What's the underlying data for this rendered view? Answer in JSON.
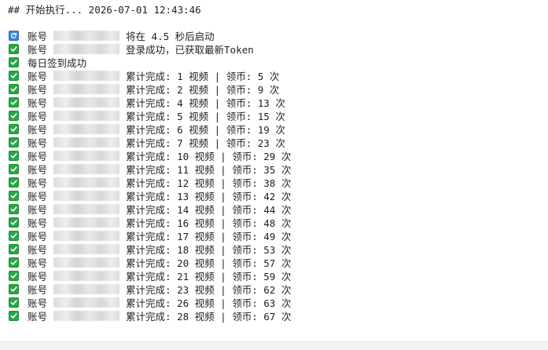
{
  "header": {
    "text": "## 开始执行... 2026-07-01 12:43:46"
  },
  "log": {
    "lines": [
      {
        "icon": "refresh-icon",
        "label": "账号",
        "masked": true,
        "message": "将在 4.5 秒后启动"
      },
      {
        "icon": "check-icon",
        "label": "账号",
        "masked": true,
        "message": "登录成功，已获取最新Token"
      },
      {
        "icon": "check-icon",
        "label": "",
        "masked": false,
        "message": "每日签到成功"
      },
      {
        "icon": "check-icon",
        "label": "账号",
        "masked": true,
        "message": "累计完成: 1 视频 | 领币: 5 次"
      },
      {
        "icon": "check-icon",
        "label": "账号",
        "masked": true,
        "message": "累计完成: 2 视频 | 领币: 9 次"
      },
      {
        "icon": "check-icon",
        "label": "账号",
        "masked": true,
        "message": "累计完成: 4 视频 | 领币: 13 次"
      },
      {
        "icon": "check-icon",
        "label": "账号",
        "masked": true,
        "message": "累计完成: 5 视频 | 领币: 15 次"
      },
      {
        "icon": "check-icon",
        "label": "账号",
        "masked": true,
        "message": "累计完成: 6 视频 | 领币: 19 次"
      },
      {
        "icon": "check-icon",
        "label": "账号",
        "masked": true,
        "message": "累计完成: 7 视频 | 领币: 23 次"
      },
      {
        "icon": "check-icon",
        "label": "账号",
        "masked": true,
        "message": "累计完成: 10 视频 | 领币: 29 次"
      },
      {
        "icon": "check-icon",
        "label": "账号",
        "masked": true,
        "message": "累计完成: 11 视频 | 领币: 35 次"
      },
      {
        "icon": "check-icon",
        "label": "账号",
        "masked": true,
        "message": "累计完成: 12 视频 | 领币: 38 次"
      },
      {
        "icon": "check-icon",
        "label": "账号",
        "masked": true,
        "message": "累计完成: 13 视频 | 领币: 42 次"
      },
      {
        "icon": "check-icon",
        "label": "账号",
        "masked": true,
        "message": "累计完成: 14 视频 | 领币: 44 次"
      },
      {
        "icon": "check-icon",
        "label": "账号",
        "masked": true,
        "message": "累计完成: 16 视频 | 领币: 48 次"
      },
      {
        "icon": "check-icon",
        "label": "账号",
        "masked": true,
        "message": "累计完成: 17 视频 | 领币: 49 次"
      },
      {
        "icon": "check-icon",
        "label": "账号",
        "masked": true,
        "message": "累计完成: 18 视频 | 领币: 53 次"
      },
      {
        "icon": "check-icon",
        "label": "账号",
        "masked": true,
        "message": "累计完成: 20 视频 | 领币: 57 次"
      },
      {
        "icon": "check-icon",
        "label": "账号",
        "masked": true,
        "message": "累计完成: 21 视频 | 领币: 59 次"
      },
      {
        "icon": "check-icon",
        "label": "账号",
        "masked": true,
        "message": "累计完成: 23 视频 | 领币: 62 次"
      },
      {
        "icon": "check-icon",
        "label": "账号",
        "masked": true,
        "message": "累计完成: 26 视频 | 领币: 63 次"
      },
      {
        "icon": "check-icon",
        "label": "账号",
        "masked": true,
        "message": "累计完成: 28 视频 | 领币: 67 次"
      }
    ]
  },
  "colors": {
    "check": "#27a844",
    "refresh": "#3b86d9",
    "text": "#1f1f1f",
    "background": "#ffffff"
  }
}
